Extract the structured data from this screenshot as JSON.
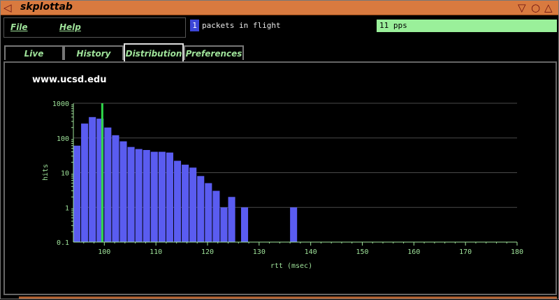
{
  "window": {
    "title": "skplottab",
    "icons": {
      "left": "triangle-left-icon",
      "right": [
        "triangle-down-icon",
        "circle-icon",
        "triangle-up-icon"
      ]
    },
    "title_color": "#d97a3f"
  },
  "menu": {
    "file": "File",
    "help": "Help"
  },
  "status": {
    "packets_in_flight_value": "1",
    "packets_in_flight_label": "packets in flight",
    "pps": "11 pps",
    "pps_bg": "#9af09a",
    "inflight_bg": "#3c46d8"
  },
  "tabs": [
    {
      "label": "Live",
      "active": false
    },
    {
      "label": "History",
      "active": false
    },
    {
      "label": "Distribution",
      "active": true
    },
    {
      "label": "Preferences",
      "active": false
    }
  ],
  "chart_data": {
    "type": "bar",
    "title": "www.ucsd.edu",
    "xlabel": "rtt (msec)",
    "ylabel": "hits",
    "x_range": [
      94,
      180
    ],
    "x_ticks": [
      100,
      110,
      120,
      130,
      140,
      150,
      160,
      170,
      180
    ],
    "y_scale": "log",
    "y_range": [
      0.1,
      1000
    ],
    "y_ticks": [
      "0.1",
      "1",
      "10",
      "100",
      "1000"
    ],
    "grid": true,
    "bin_width_msec": 1.5,
    "bar_color": "#5a5cf0",
    "marker_color": "#2fd84a",
    "marker_x": 99.6,
    "bins": [
      {
        "x": 94.0,
        "value": 60
      },
      {
        "x": 95.5,
        "value": 260
      },
      {
        "x": 97.0,
        "value": 400
      },
      {
        "x": 98.5,
        "value": 360
      },
      {
        "x": 100.0,
        "value": 200
      },
      {
        "x": 101.5,
        "value": 120
      },
      {
        "x": 103.0,
        "value": 80
      },
      {
        "x": 104.5,
        "value": 55
      },
      {
        "x": 106.0,
        "value": 48
      },
      {
        "x": 107.5,
        "value": 45
      },
      {
        "x": 109.0,
        "value": 40
      },
      {
        "x": 110.5,
        "value": 40
      },
      {
        "x": 112.0,
        "value": 38
      },
      {
        "x": 113.5,
        "value": 22
      },
      {
        "x": 115.0,
        "value": 17
      },
      {
        "x": 116.5,
        "value": 14
      },
      {
        "x": 118.0,
        "value": 8
      },
      {
        "x": 119.5,
        "value": 5
      },
      {
        "x": 121.0,
        "value": 3
      },
      {
        "x": 122.5,
        "value": 1
      },
      {
        "x": 124.0,
        "value": 2
      },
      {
        "x": 126.5,
        "value": 1
      },
      {
        "x": 136.0,
        "value": 1
      }
    ]
  }
}
